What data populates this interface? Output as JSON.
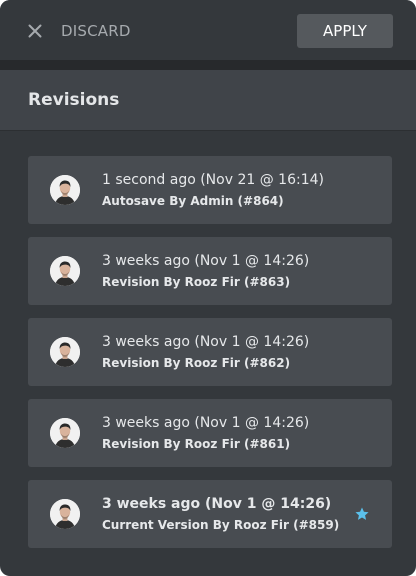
{
  "toolbar": {
    "close_icon": "close-icon",
    "discard_label": "DISCARD",
    "apply_label": "APPLY"
  },
  "section": {
    "title": "Revisions"
  },
  "colors": {
    "panel": "#34383c",
    "card": "#484c51",
    "apply_button": "#55595d",
    "star_accent": "#5bc0eb"
  },
  "revisions": [
    {
      "date": "1 second ago (Nov 21 @ 16:14)",
      "by": "Autosave By Admin (#864)",
      "current": false
    },
    {
      "date": "3 weeks ago (Nov 1 @ 14:26)",
      "by": "Revision By Rooz Fir (#863)",
      "current": false
    },
    {
      "date": "3 weeks ago (Nov 1 @ 14:26)",
      "by": "Revision By Rooz Fir (#862)",
      "current": false
    },
    {
      "date": "3 weeks ago (Nov 1 @ 14:26)",
      "by": "Revision By Rooz Fir (#861)",
      "current": false
    },
    {
      "date": "3 weeks ago (Nov 1 @ 14:26)",
      "by": "Current Version By Rooz Fir (#859)",
      "current": true,
      "icon": "star-icon"
    }
  ]
}
